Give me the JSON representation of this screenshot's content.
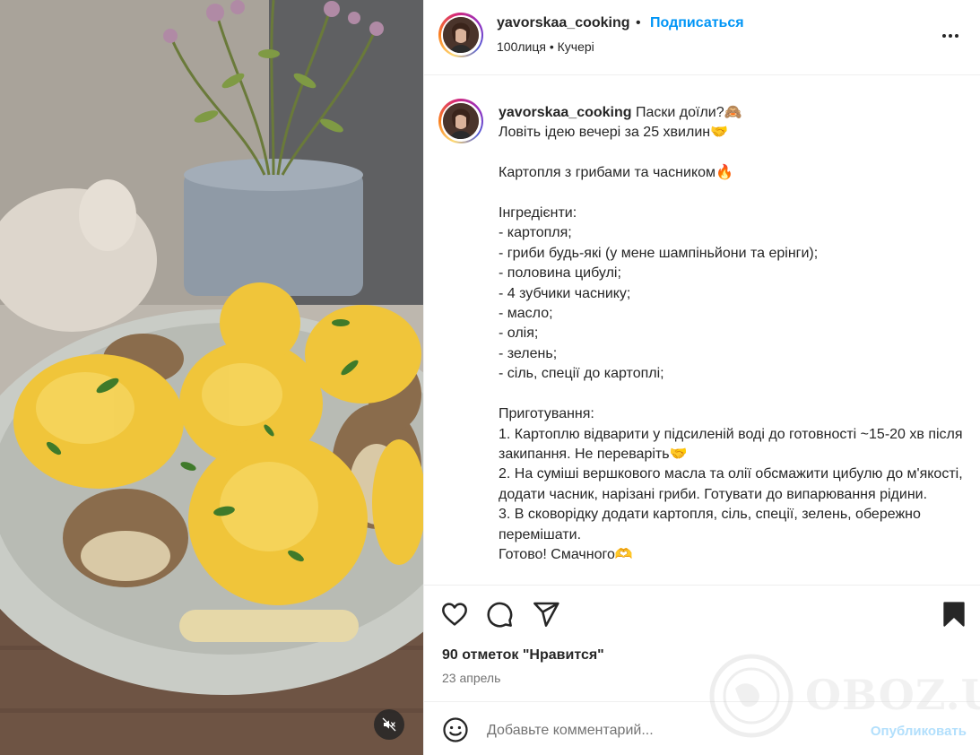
{
  "post": {
    "username": "yavorskaa_cooking",
    "separator": "•",
    "follow_label": "Подписаться",
    "subtitle": "100лиця • Кучері",
    "more_icon": "more-horizontal-icon"
  },
  "caption": {
    "username": "yavorskaa_cooking",
    "text": " Паски доїли?🙈\nЛовіть ідею вечері за 25 хвилин🤝\n\nКартопля з грибами та часником🔥\n\nІнгредієнти:\n- картопля;\n- гриби будь-які (у мене шампіньйони та ерінги);\n- половина цибулі;\n- 4 зубчики часнику;\n- масло;\n- олія;\n- зелень;\n- сіль, спеції до картоплі;\n\nПриготування:\n1. Картоплю відварити у підсиленій воді до готовності ~15-20 хв після закипання. Не переварiть🤝\n2. На суміші вершкового масла та олії обсмажити цибулю до м'якості, додати часник, нарізані гриби. Готувати до випарювання рідини.\n3. В сковорідку додати картопля, сіль, спеції, зелень, обережно перемішати.\nГотово! Смачного🫶"
  },
  "actions": {
    "like_icon": "heart-icon",
    "comment_icon": "comment-icon",
    "share_icon": "send-icon",
    "save_icon": "bookmark-icon",
    "likes_text": "90 отметок \"Нравится\"",
    "date": "23 апрель"
  },
  "comment": {
    "placeholder": "Добавьте комментарий...",
    "publish_label": "Опубликовать",
    "emoji_icon": "emoji-icon"
  },
  "media": {
    "mute_icon": "speaker-muted-icon"
  },
  "watermark": {
    "text": "OBOZ.UA"
  },
  "colors": {
    "accent": "#0095f6",
    "publish_disabled": "#b2dffc",
    "text": "#262626",
    "secondary": "#737373"
  }
}
